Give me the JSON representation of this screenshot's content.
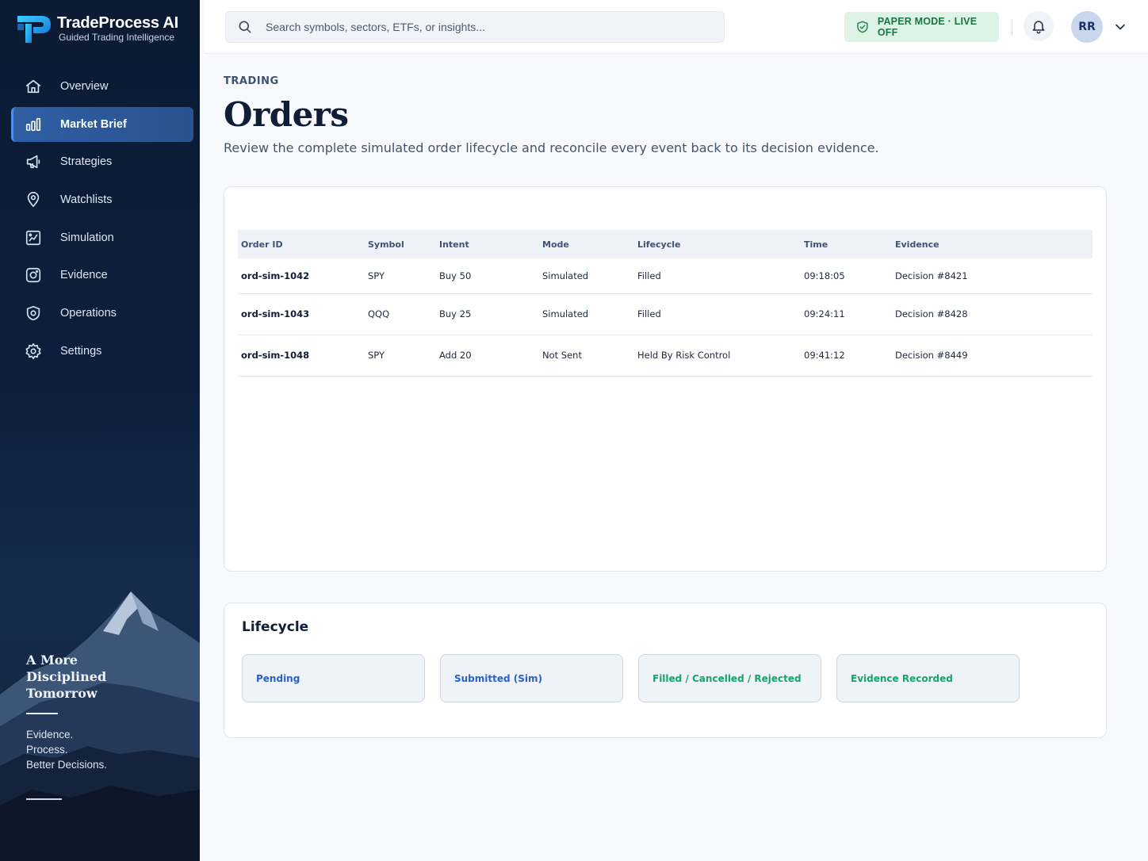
{
  "brand": {
    "title": "TradeProcess AI",
    "subtitle": "Guided Trading Intelligence",
    "logo_icon": "tp-logo-mark"
  },
  "sidebar": {
    "items": [
      {
        "label": "Overview",
        "icon": "home-icon",
        "active": false
      },
      {
        "label": "Market Brief",
        "icon": "bar-chart-icon",
        "active": true
      },
      {
        "label": "Strategies",
        "icon": "megaphone-icon",
        "active": false
      },
      {
        "label": "Watchlists",
        "icon": "map-pin-icon",
        "active": false
      },
      {
        "label": "Simulation",
        "icon": "simulation-chart-icon",
        "active": false
      },
      {
        "label": "Evidence",
        "icon": "evidence-icon",
        "active": false
      },
      {
        "label": "Operations",
        "icon": "shield-icon",
        "active": false
      },
      {
        "label": "Settings",
        "icon": "gear-icon",
        "active": false
      }
    ],
    "tagline": {
      "heading_lines": [
        "A More",
        "Disciplined",
        "Tomorrow"
      ],
      "lines": [
        "Evidence.",
        "Process.",
        "Better Decisions."
      ]
    }
  },
  "header": {
    "search_placeholder": "Search symbols, sectors, ETFs, or insights...",
    "mode_badge": "PAPER MODE · LIVE OFF",
    "avatar_initials": "RR"
  },
  "page": {
    "eyebrow": "TRADING",
    "title": "Orders",
    "description": "Review the complete simulated order lifecycle and reconcile every event back to its decision evidence."
  },
  "orders_table": {
    "columns": [
      "Order ID",
      "Symbol",
      "Intent",
      "Mode",
      "Lifecycle",
      "Time",
      "Evidence"
    ],
    "rows": [
      [
        "ord-sim-1042",
        "SPY",
        "Buy 50",
        "Simulated",
        "Filled",
        "09:18:05",
        "Decision #8421"
      ],
      [
        "ord-sim-1043",
        "QQQ",
        "Buy 25",
        "Simulated",
        "Filled",
        "09:24:11",
        "Decision #8428"
      ],
      [
        "ord-sim-1048",
        "SPY",
        "Add 20",
        "Not Sent",
        "Held By Risk Control",
        "09:41:12",
        "Decision #8449"
      ]
    ]
  },
  "lifecycle": {
    "title": "Lifecycle",
    "stages": [
      {
        "label": "Pending",
        "tone": "blue"
      },
      {
        "label": "Submitted (Sim)",
        "tone": "blue"
      },
      {
        "label": "Filled / Cancelled / Rejected",
        "tone": "green"
      },
      {
        "label": "Evidence Recorded",
        "tone": "green"
      }
    ]
  },
  "colors": {
    "accent": "#2f5fa3",
    "success": "#197543",
    "stage_blue": "#2c5fc4",
    "stage_green": "#18a36a"
  }
}
